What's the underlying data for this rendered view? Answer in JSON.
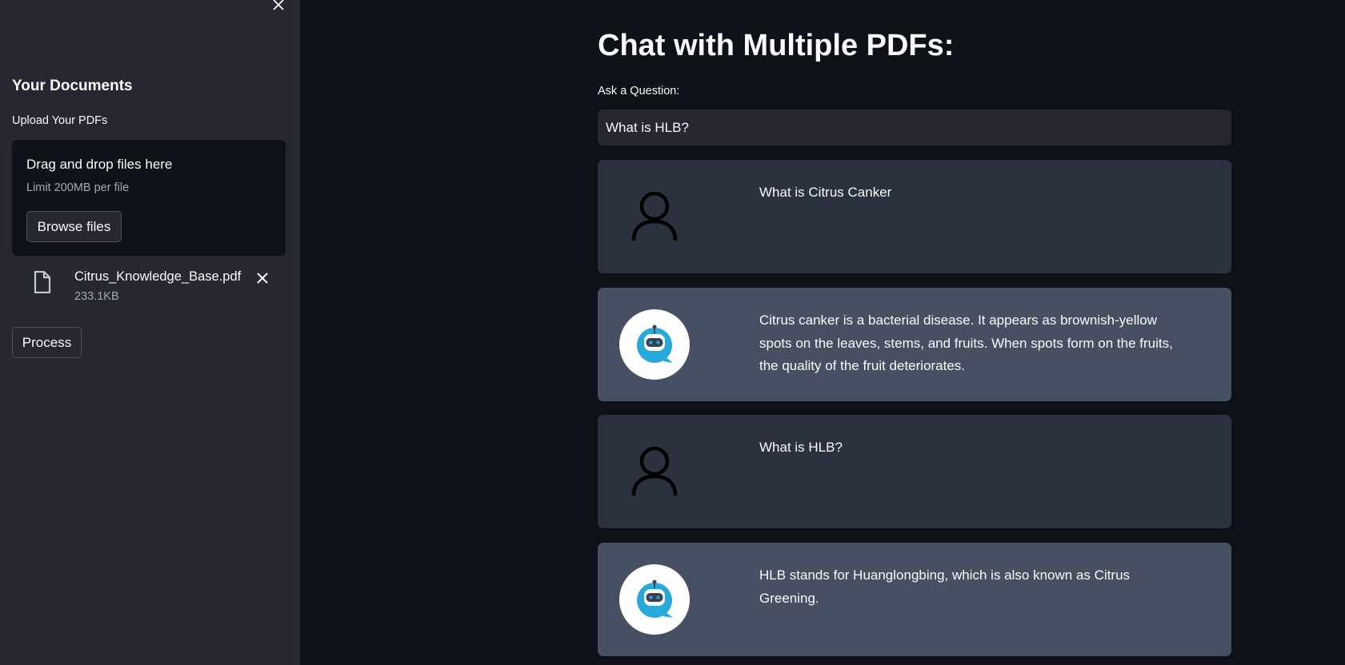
{
  "sidebar": {
    "heading": "Your Documents",
    "upload_label": "Upload Your PDFs",
    "dropzone": {
      "title": "Drag and drop files here",
      "limit": "Limit 200MB per file",
      "browse_label": "Browse files"
    },
    "files": [
      {
        "name": "Citrus_Knowledge_Base.pdf",
        "size": "233.1KB"
      }
    ],
    "process_label": "Process"
  },
  "main": {
    "title": "Chat with Multiple PDFs:",
    "ask_label": "Ask a Question:",
    "question_value": "What is HLB?"
  },
  "messages": [
    {
      "role": "user",
      "avatar": "user-icon",
      "text": "What is Citrus Canker"
    },
    {
      "role": "bot",
      "avatar": "robot-icon",
      "text": "Citrus canker is a bacterial disease. It appears as brownish-yellow spots on the leaves, stems, and fruits. When spots form on the fruits, the quality of the fruit deteriorates."
    },
    {
      "role": "user",
      "avatar": "user-icon",
      "text": "What is HLB?"
    },
    {
      "role": "bot",
      "avatar": "robot-icon",
      "text": "HLB stands for Huanglongbing, which is also known as Citrus Greening."
    }
  ],
  "colors": {
    "background": "#0e1117",
    "sidebar": "#262730",
    "user_message": "#2b313e",
    "bot_message": "#475063",
    "bot_avatar_accent": "#29a9d9"
  }
}
